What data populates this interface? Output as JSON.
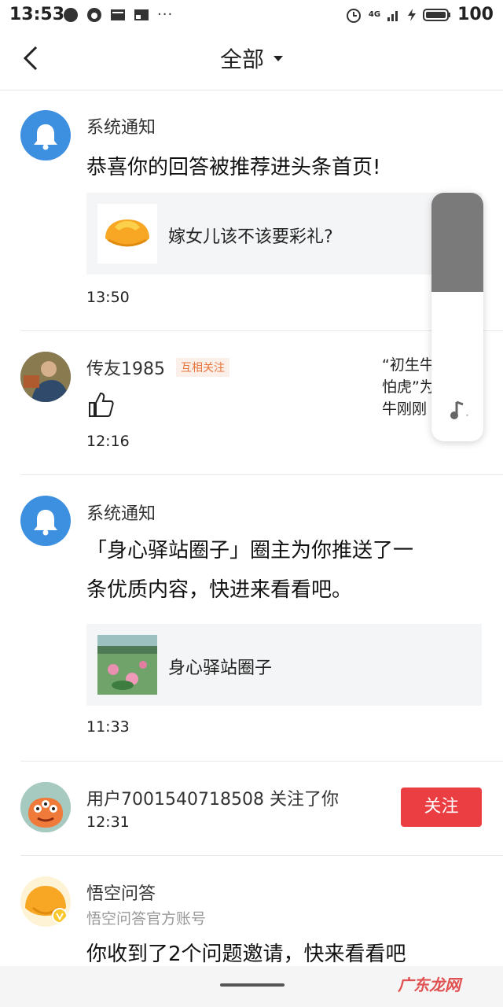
{
  "status_bar": {
    "time": "13:53",
    "dots": "···",
    "network": "4G",
    "battery": "100"
  },
  "header": {
    "back_icon": "chevron-left-icon",
    "title": "全部"
  },
  "notifications": [
    {
      "sender": "系统通知",
      "message": "恭喜你的回答被推荐进头条首页!",
      "card_text": "嫁女儿该不该要彩礼?",
      "time": "13:50"
    },
    {
      "sender": "传友1985",
      "tag": "互相关注",
      "action_icon": "thumbs-up-icon",
      "side_text": [
        "“初生牛",
        "怕虎”为",
        "牛刚刚"
      ],
      "time": "12:16"
    },
    {
      "sender": "系统通知",
      "message_lines": [
        "「身心驿站圈子」圈主为你推送了一",
        "条优质内容，快进来看看吧。"
      ],
      "card_text": "身心驿站圈子",
      "time": "11:33"
    },
    {
      "sender": "用户7001540718508 关注了你",
      "time": "12:31",
      "button": "关注"
    },
    {
      "sender": "悟空问答",
      "subtitle": "悟空问答官方账号",
      "message": "你收到了2个问题邀请，快来看看吧"
    }
  ],
  "watermark": "广东龙网",
  "colors": {
    "accent_red": "#ea3e43",
    "bell_blue": "#3d8fe0",
    "tag_orange": "#e8743b"
  }
}
